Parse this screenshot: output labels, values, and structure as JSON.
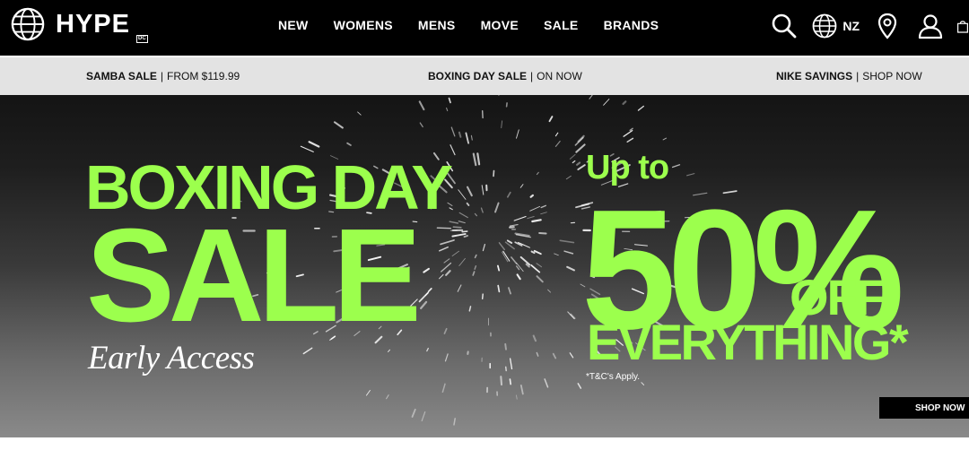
{
  "header": {
    "logo_text": "HYPE",
    "logo_sub": "DC",
    "nav": [
      "NEW",
      "WOMENS",
      "MENS",
      "MOVE",
      "SALE",
      "BRANDS"
    ],
    "region": "NZ",
    "icons": [
      "search-icon",
      "globe-icon",
      "location-pin-icon",
      "account-icon",
      "cart-icon"
    ]
  },
  "promo_bar": [
    {
      "title": "SAMBA SALE",
      "detail": "FROM $119.99"
    },
    {
      "title": "BOXING DAY SALE",
      "detail": "ON NOW"
    },
    {
      "title": "NIKE SAVINGS",
      "detail": "SHOP NOW"
    }
  ],
  "hero": {
    "line1": "BOXING DAY",
    "line2": "SALE",
    "tagline": "Early Access",
    "up_to": "Up to",
    "percent": "50%",
    "off": "OFF",
    "everything": "EVERYTHING*",
    "terms": "*T&C's Apply.",
    "cta": "SHOP NOW"
  },
  "colors": {
    "accent": "#9cff4d",
    "header_bg": "#000000",
    "promo_bg": "#e3e3e3"
  }
}
